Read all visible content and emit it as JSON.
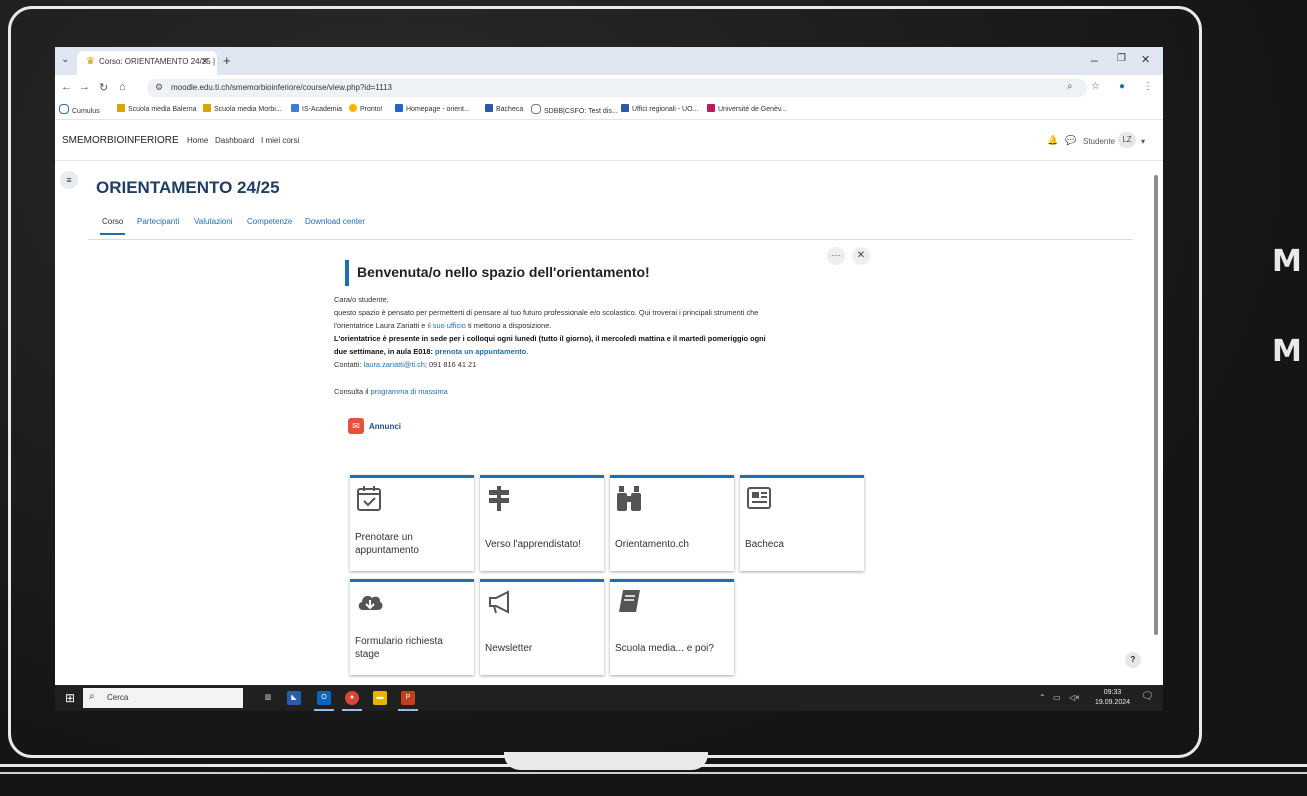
{
  "side_text": [
    "M",
    "M"
  ],
  "browser": {
    "tab_title": "Corso: ORIENTAMENTO 24/25 |",
    "tab_close": "✕",
    "new_tab": "+",
    "url": "moodle.edu.ti.ch/smemorbioinferiore/course/view.php?id=1113",
    "bookmarks": [
      {
        "label": "Cumulus",
        "color": "#2b6cc4"
      },
      {
        "label": "Scuola media Balerna",
        "color": "#d8a400"
      },
      {
        "label": "Scuola media Morbi...",
        "color": "#d8a400"
      },
      {
        "label": "IS-Academia",
        "color": "#3b7dd8"
      },
      {
        "label": "Pronto!",
        "color": "#ffb400"
      },
      {
        "label": "Homepage - orient...",
        "color": "#1e66c9"
      },
      {
        "label": "Bacheca",
        "color": "#2e56a8"
      },
      {
        "label": "SDBB|CSFO: Test dis...",
        "color": "#777777"
      },
      {
        "label": "Uffici regionali - UO...",
        "color": "#2e56a8"
      },
      {
        "label": "Université de Genèv...",
        "color": "#c2185b"
      }
    ]
  },
  "moodle_nav": {
    "site_name": "SMEMORBIOINFERIORE",
    "links": [
      "Home",
      "Dashboard",
      "I miei corsi"
    ],
    "user_label": "Studente",
    "avatar": "LZ"
  },
  "course": {
    "title": "ORIENTAMENTO 24/25",
    "tabs": [
      "Corso",
      "Partecipanti",
      "Valutazioni",
      "Competenze",
      "Download center"
    ]
  },
  "welcome": {
    "title": "Benvenuta/o nello spazio dell'orientamento!",
    "greeting": "Cara/o studente,",
    "line1": "questo spazio è pensato per permetterti di pensare al tuo futuro professionale e/o scolastico. Qui troverai i principali strumenti che",
    "line2_pre": "l'orientatrice Laura Zariatti e ",
    "line2_link": "il suo ufficio",
    "line2_post": " ti mettono a disposizione.",
    "bold1": "L'orientatrice è presente in sede per i colloqui ogni lunedì (tutto il giorno), il mercoledì mattina e il martedì pomeriggio ogni",
    "bold2_pre": "due settimane, in aula E018: ",
    "bold2_link": "prenota un appuntamento.",
    "contact_pre": "Contatti: ",
    "contact_link": "laura.zariatti@ti.ch",
    "contact_post": "; 091 816 41 21",
    "program_pre": "Consulta il ",
    "program_link": "programma di massima"
  },
  "annunci": "Annunci",
  "tiles": [
    {
      "label": "Prenotare un appuntamento",
      "icon": "calendar-check-icon",
      "glyph": "🗓"
    },
    {
      "label": "Verso l'apprendistato!",
      "icon": "signpost-icon",
      "glyph": "⚑"
    },
    {
      "label": "Orientamento.ch",
      "icon": "binoculars-icon",
      "glyph": "⛓"
    },
    {
      "label": "Bacheca",
      "icon": "newspaper-icon",
      "glyph": "▤"
    },
    {
      "label": "Formulario richiesta stage",
      "icon": "cloud-download-icon",
      "glyph": "☁"
    },
    {
      "label": "Newsletter",
      "icon": "megaphone-icon",
      "glyph": "📢"
    },
    {
      "label": "Scuola media... e poi?",
      "icon": "book-icon",
      "glyph": "📘"
    }
  ],
  "help": "?",
  "taskbar": {
    "search": "Cerca",
    "time": "09:33",
    "date": "19.09.2024"
  },
  "colors": {
    "accent": "#1f6fb5",
    "title": "#1e3e66"
  }
}
